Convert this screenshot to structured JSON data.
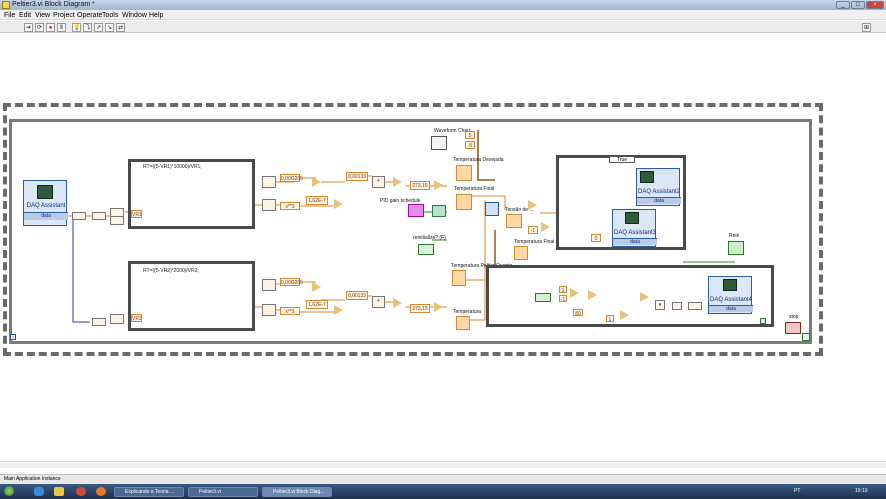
{
  "window": {
    "title": "Peltier3.vi Block Diagram *",
    "controls": [
      "_",
      "□",
      "×"
    ]
  },
  "menu": [
    "File",
    "Edit",
    "View",
    "Project",
    "Operate",
    "Tools",
    "Window",
    "Help"
  ],
  "toolbar": [
    "➔",
    "⟳",
    "●",
    "Ⅱ",
    "💡",
    "⤵",
    "↗",
    "↘",
    "⇄",
    "⊞"
  ],
  "diagram": {
    "daq1": {
      "title": "DAQ Assistant",
      "data": "data"
    },
    "formula1": "RT=((5-VR1)*10000)/VR1;",
    "formula2": "RT=((5-VR2)*2000)/VR2;",
    "vr1": "VR1",
    "vr2": "VR2",
    "const_a1": "0,00G205",
    "const_b1": "1,62E-7",
    "const_c1": "0,00133",
    "const_a2": "0,00G205",
    "const_b2": "1,62E-7",
    "const_c2": "0,00133",
    "k1": "273,15",
    "k2": "273,15",
    "wave_label": "Waveform Chart",
    "temp_desejada": "Temperatura Desejada",
    "temp_final": "Temperatura Final",
    "pid": "PID gain schedule",
    "reinit": "reinitialize? (F)",
    "tensao": "Tensão de ...",
    "temp_final2": "Temperatura Final",
    "temp_quente": "Temperatura Peltier Quente",
    "temperatura": "Temperatura",
    "case_sel": "True",
    "daq2": {
      "title": "DAQ Assistant2",
      "data": "data"
    },
    "daq3": {
      "title": "DAQ Assistant3",
      "data": "data"
    },
    "daq4": {
      "title": "DAQ Assistant4",
      "data": "data"
    },
    "rele": "Relé",
    "stop": "stop",
    "c5": "5",
    "c_neg5": "-5",
    "c0": "0",
    "c1": "1",
    "c_neg1": "-1",
    "c80": "80",
    "c1b": "1",
    "c_neg1b": "-1",
    "iter": "i",
    "iter2": "i"
  },
  "status": "Main Application Instance",
  "taskbar": {
    "items": [
      "Explicando a Teoria ...",
      "Peltier3.vi",
      "Peltier3.vi Block Diag..."
    ],
    "lang": "PT",
    "time": "19:19"
  }
}
